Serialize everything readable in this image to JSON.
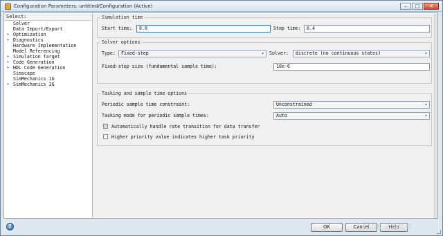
{
  "window": {
    "title": "Configuration Parameters: untitled/Configuration (Active)",
    "minimize_glyph": "–",
    "maximize_glyph": "□",
    "close_glyph": "✕"
  },
  "tree": {
    "header": "Select:",
    "items": [
      {
        "label": "Solver",
        "expander": ""
      },
      {
        "label": "Data Import/Export",
        "expander": ""
      },
      {
        "label": "Optimization",
        "expander": "▸"
      },
      {
        "label": "Diagnostics",
        "expander": "▸"
      },
      {
        "label": "Hardware Implementation",
        "expander": ""
      },
      {
        "label": "Model Referencing",
        "expander": ""
      },
      {
        "label": "Simulation Target",
        "expander": "▸"
      },
      {
        "label": "Code Generation",
        "expander": "▸"
      },
      {
        "label": "HDL Code Generation",
        "expander": "▸"
      },
      {
        "label": "Simscape",
        "expander": ""
      },
      {
        "label": "SimMechanics 1G",
        "expander": ""
      },
      {
        "label": "SimMechanics 2G",
        "expander": "▸"
      }
    ]
  },
  "simulation_time": {
    "title": "Simulation time",
    "start_label": "Start time:",
    "start_value": "0.0",
    "stop_label": "Stop time:",
    "stop_value": "0.4"
  },
  "solver_options": {
    "title": "Solver options",
    "type_label": "Type:",
    "type_value": "Fixed-step",
    "solver_label": "Solver:",
    "solver_value": "discrete (no continuous states)",
    "step_size_label": "Fixed-step size (fundamental sample time):",
    "step_size_value": "10e-6"
  },
  "tasking": {
    "title": "Tasking and sample time options",
    "periodic_label": "Periodic sample time constraint:",
    "periodic_value": "Unconstrained",
    "tasking_mode_label": "Tasking mode for periodic sample times:",
    "tasking_mode_value": "Auto",
    "auto_rate_label": "Automatically handle rate transition for data transfer",
    "auto_rate_checked": true,
    "priority_label": "Higher priority value indicates higher task priority",
    "priority_checked": false
  },
  "footer": {
    "help_glyph": "?",
    "ok_label": "OK",
    "cancel_label": "Cancel",
    "help_label": "Help",
    "watermark": "CSDN @扬辰豪"
  },
  "icons": {
    "dropdown": "▾"
  }
}
